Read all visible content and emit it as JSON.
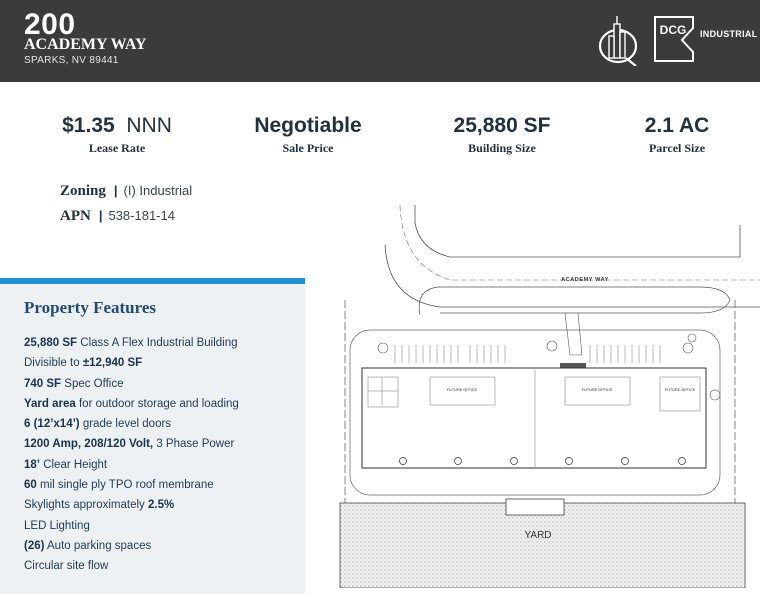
{
  "header": {
    "address_number": "200",
    "street": "ACADEMY WAY",
    "city": "SPARKS, NV 89441",
    "brand_badge": "DCG",
    "brand_text": "INDUSTRIAL"
  },
  "stats": [
    {
      "value_bold": "$1.35",
      "value_light": "NNN",
      "label": "Lease Rate"
    },
    {
      "value_bold": "Negotiable",
      "value_light": "",
      "label": "Sale Price"
    },
    {
      "value_bold": "25,880 SF",
      "value_light": "",
      "label": "Building Size"
    },
    {
      "value_bold": "2.1 AC",
      "value_light": "",
      "label": "Parcel Size"
    }
  ],
  "zoning": {
    "label": "Zoning",
    "value": "(I) Industrial"
  },
  "apn": {
    "label": "APN",
    "value": "538-181-14"
  },
  "features": {
    "title": "Property Features",
    "items": [
      {
        "bold": "25,880 SF",
        "text": " Class A Flex Industrial Building",
        "bold_after": ""
      },
      {
        "bold": "",
        "text": "Divisible to ",
        "bold_after": "±12,940 SF"
      },
      {
        "bold": "740 SF",
        "text": " Spec Office",
        "bold_after": ""
      },
      {
        "bold": "Yard area",
        "text": " for outdoor storage and loading",
        "bold_after": ""
      },
      {
        "bold": "6 (12’x14’)",
        "text": " grade level doors",
        "bold_after": ""
      },
      {
        "bold": "1200 Amp, 208/120 Volt,",
        "text": " 3 Phase Power",
        "bold_after": ""
      },
      {
        "bold": "18’",
        "text": " Clear Height",
        "bold_after": ""
      },
      {
        "bold": "60",
        "text": " mil single ply TPO roof membrane",
        "bold_after": ""
      },
      {
        "bold": "",
        "text": "Skylights approximately ",
        "bold_after": "2.5%"
      },
      {
        "bold": "",
        "text": "LED Lighting",
        "bold_after": ""
      },
      {
        "bold": "(26)",
        "text": " Auto parking spaces",
        "bold_after": ""
      },
      {
        "bold": "",
        "text": "Circular site flow",
        "bold_after": ""
      }
    ]
  },
  "site_plan": {
    "street_label": "ACADEMY WAY",
    "office_labels": [
      "FUTURE OFFICE",
      "FUTURE OFFICE",
      "FUTURE OFFICE"
    ],
    "yard_label": "YARD"
  },
  "colors": {
    "header_bg": "#3b3b3b",
    "accent": "#1f8fd1",
    "features_bg": "#eef1f4",
    "heading": "#1f4a73"
  }
}
